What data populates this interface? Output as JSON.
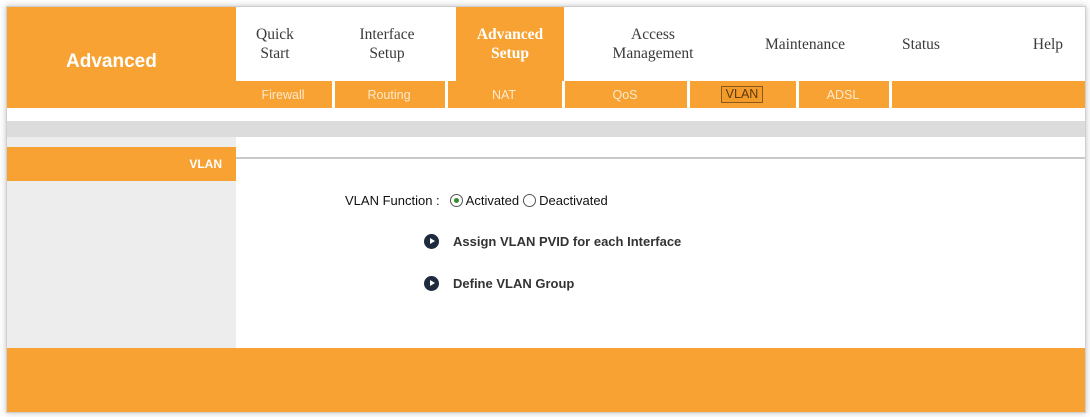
{
  "brand": {
    "title": "Advanced"
  },
  "main_tabs": [
    {
      "label": "Quick\nStart",
      "active": false
    },
    {
      "label": "Interface\nSetup",
      "active": false
    },
    {
      "label": "Advanced\nSetup",
      "active": true
    },
    {
      "label": "Access\nManagement",
      "active": false
    },
    {
      "label": "Maintenance",
      "active": false
    },
    {
      "label": "Status",
      "active": false
    },
    {
      "label": "Help",
      "active": false
    }
  ],
  "sub_tabs": [
    {
      "label": "Firewall",
      "active": false
    },
    {
      "label": "Routing",
      "active": false
    },
    {
      "label": "NAT",
      "active": false
    },
    {
      "label": "QoS",
      "active": false
    },
    {
      "label": "VLAN",
      "active": true
    },
    {
      "label": "ADSL",
      "active": false
    }
  ],
  "section": {
    "title": "VLAN"
  },
  "vlan_function": {
    "label": "VLAN Function :",
    "options": [
      {
        "label": "Activated",
        "checked": true
      },
      {
        "label": "Deactivated",
        "checked": false
      }
    ]
  },
  "links": [
    {
      "label": "Assign VLAN PVID for each Interface"
    },
    {
      "label": "Define VLAN Group"
    }
  ],
  "colors": {
    "accent": "#f7a233",
    "panel": "#ededed",
    "text": "#333333"
  }
}
